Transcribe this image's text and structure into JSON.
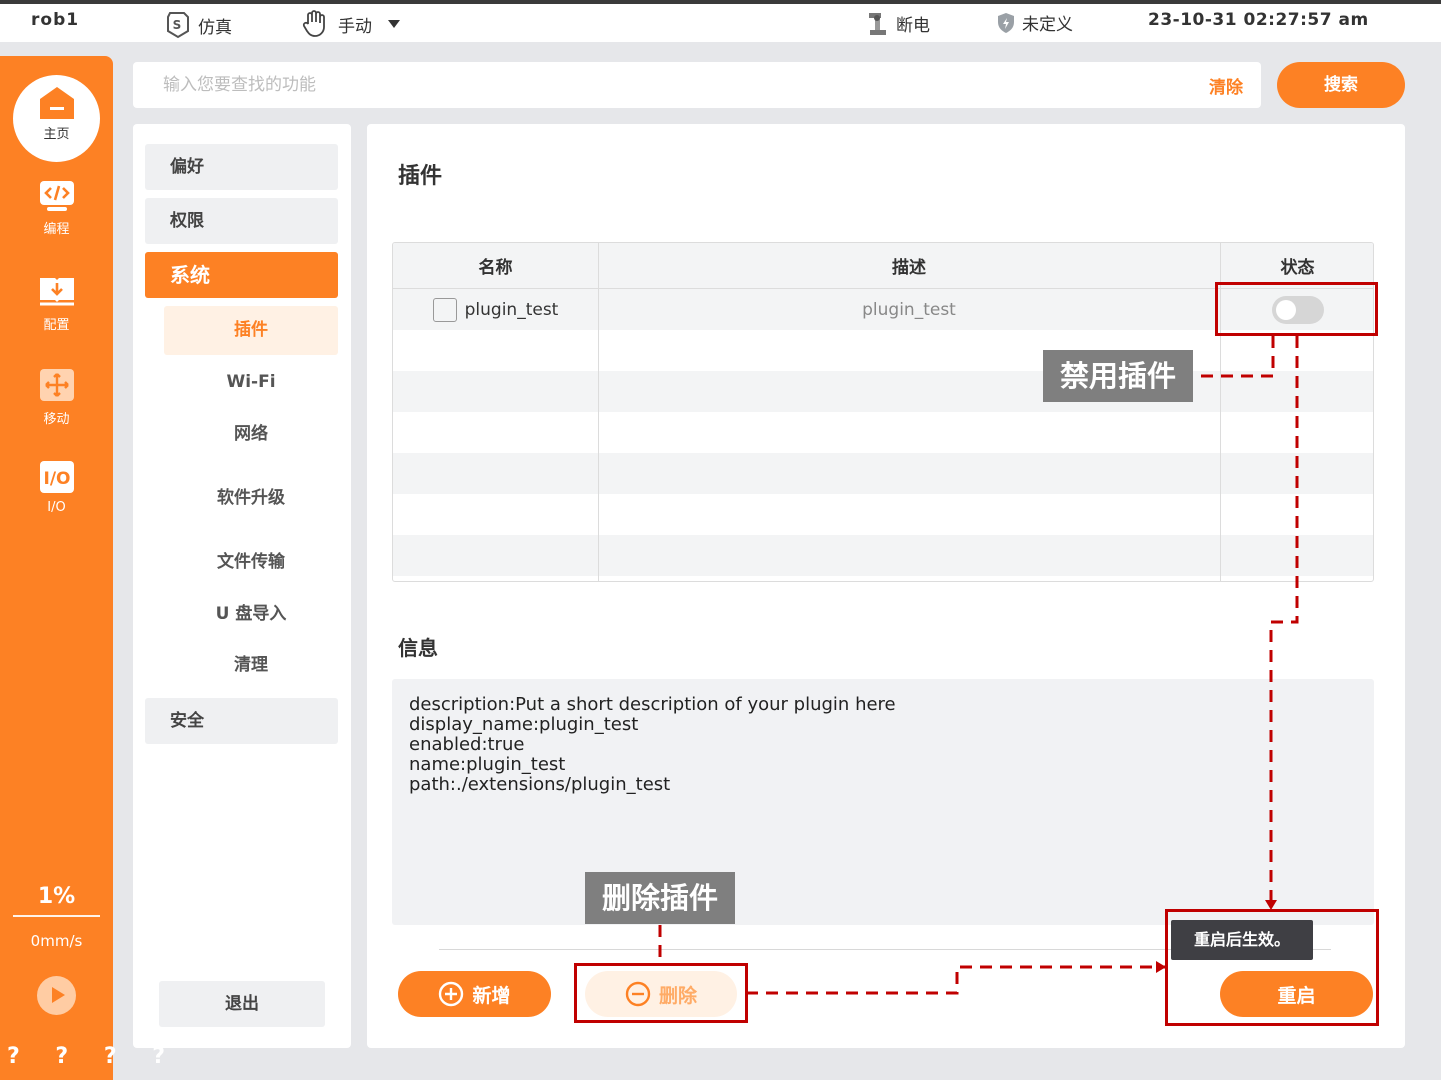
{
  "topbar": {
    "robot_name": "rob1",
    "mode_sim": "仿真",
    "mode_manual": "手动",
    "power_status": "断电",
    "safety_status": "未定义",
    "clock": "23-10-31 02:27:57 am"
  },
  "rail": {
    "home": "主页",
    "items": [
      "编程",
      "配置",
      "移动",
      "I/O"
    ],
    "speed_percent": "1%",
    "speed_value": "0mm/s",
    "footer": "? ? ? ?"
  },
  "search": {
    "placeholder": "输入您要查找的功能",
    "clear_label": "清除",
    "search_label": "搜索"
  },
  "nav": {
    "groups": [
      "偏好",
      "权限",
      "系统",
      "安全"
    ],
    "system_items": [
      "插件",
      "Wi-Fi",
      "网络",
      "软件升级",
      "文件传输",
      "U 盘导入",
      "清理"
    ],
    "logout": "退出"
  },
  "main": {
    "title": "插件",
    "columns": [
      "名称",
      "描述",
      "状态"
    ],
    "rows": [
      {
        "name": "plugin_test",
        "description": "plugin_test",
        "enabled": false
      }
    ],
    "info_title": "信息",
    "info_lines": [
      "description:Put a short description of your plugin here",
      "display_name:plugin_test",
      "enabled:true",
      "name:plugin_test",
      "path:./extensions/plugin_test"
    ],
    "add_label": "新增",
    "delete_label": "删除",
    "restart_label": "重启",
    "tooltip": "重启后生效。"
  },
  "annotations": {
    "disable_plugin": "禁用插件",
    "delete_plugin": "删除插件"
  },
  "colors": {
    "accent": "#fd8124",
    "accent_light": "#fff1e4",
    "annotation_red": "#c00000",
    "annotation_label_bg": "#7f7f7f"
  }
}
